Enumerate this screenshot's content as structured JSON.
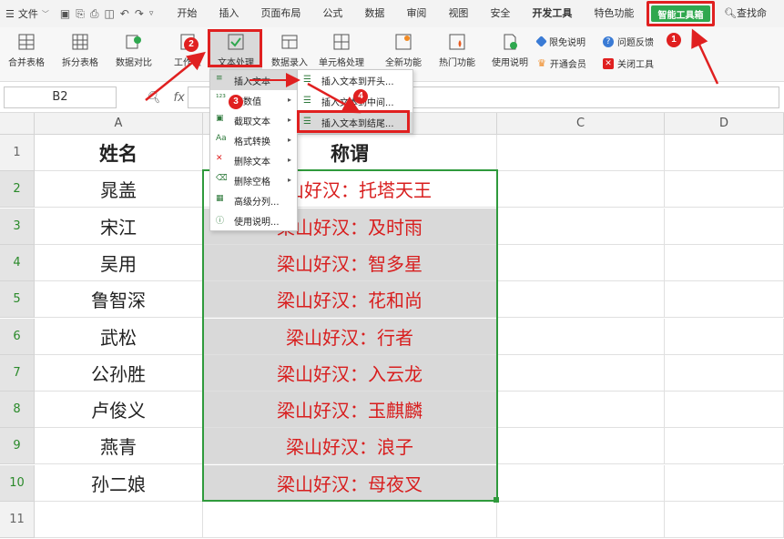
{
  "menubar": {
    "file_label": "文件",
    "tabs": [
      {
        "label": "开始",
        "bold": false
      },
      {
        "label": "插入",
        "bold": false
      },
      {
        "label": "页面布局",
        "bold": false
      },
      {
        "label": "公式",
        "bold": false
      },
      {
        "label": "数据",
        "bold": false
      },
      {
        "label": "审阅",
        "bold": false
      },
      {
        "label": "视图",
        "bold": false
      },
      {
        "label": "安全",
        "bold": false
      },
      {
        "label": "开发工具",
        "bold": true
      },
      {
        "label": "特色功能",
        "bold": false
      }
    ],
    "smart_toolbox": "智能工具箱",
    "search_command": "查找命令、"
  },
  "ribbon": {
    "buttons": [
      "合并表格",
      "拆分表格",
      "数据对比",
      "工作表",
      "文本处理",
      "数据录入",
      "单元格处理",
      "全新功能",
      "热门功能",
      "使用说明"
    ],
    "small_buttons": [
      "限免说明",
      "开通会员",
      "问题反馈",
      "关闭工具"
    ]
  },
  "formula_bar": {
    "cell_ref": "B2",
    "fx": "fx"
  },
  "columns": [
    "A",
    "B",
    "C",
    "D"
  ],
  "rows": [
    {
      "num": "1",
      "a": "姓名",
      "b": "称谓"
    },
    {
      "num": "2",
      "a": "晁盖",
      "b": "梁山好汉：托塔天王"
    },
    {
      "num": "3",
      "a": "宋江",
      "b": "梁山好汉：及时雨"
    },
    {
      "num": "4",
      "a": "吴用",
      "b": "梁山好汉：智多星"
    },
    {
      "num": "5",
      "a": "鲁智深",
      "b": "梁山好汉：花和尚"
    },
    {
      "num": "6",
      "a": "武松",
      "b": "梁山好汉：行者"
    },
    {
      "num": "7",
      "a": "公孙胜",
      "b": "梁山好汉：入云龙"
    },
    {
      "num": "8",
      "a": "卢俊义",
      "b": "梁山好汉：玉麒麟"
    },
    {
      "num": "9",
      "a": "燕青",
      "b": "梁山好汉：浪子"
    },
    {
      "num": "10",
      "a": "孙二娘",
      "b": "梁山好汉：母夜叉"
    },
    {
      "num": "11",
      "a": "",
      "b": ""
    }
  ],
  "text_menu": {
    "items": [
      {
        "label": "插入文本",
        "has_sub": true
      },
      {
        "label": "空数值",
        "has_sub": true
      },
      {
        "label": "截取文本",
        "has_sub": true
      },
      {
        "label": "格式转换",
        "has_sub": true
      },
      {
        "label": "删除文本",
        "has_sub": true
      },
      {
        "label": "删除空格",
        "has_sub": true
      },
      {
        "label": "高级分列...",
        "has_sub": false
      },
      {
        "label": "使用说明...",
        "has_sub": false
      }
    ],
    "submenu": [
      "插入文本到开头...",
      "插入文本到中间...",
      "插入文本到结尾..."
    ]
  },
  "annotations": {
    "step1": "1",
    "step2": "2",
    "step3": "3",
    "step4": "4"
  },
  "colors": {
    "accent_red": "#e02020",
    "toolbox_green": "#2fa84f",
    "selection_green": "#2f9a3c",
    "text_red": "#d81e1e"
  }
}
